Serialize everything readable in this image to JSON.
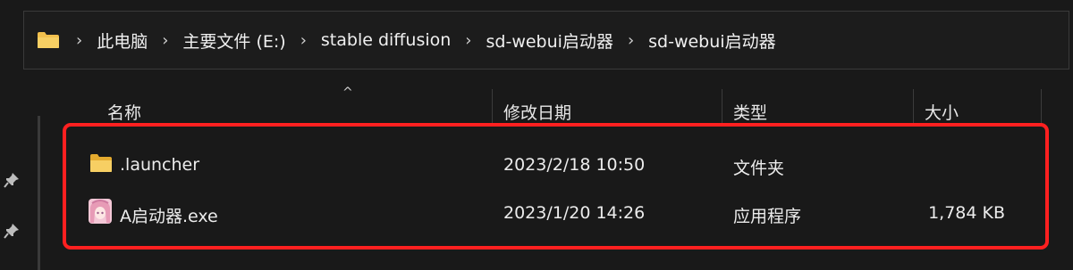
{
  "breadcrumb": [
    "此电脑",
    "主要文件 (E:)",
    "stable diffusion",
    "sd-webui启动器",
    "sd-webui启动器"
  ],
  "columns": {
    "name": "名称",
    "modified": "修改日期",
    "type": "类型",
    "size": "大小"
  },
  "files": [
    {
      "name": ".launcher",
      "modified": "2023/2/18 10:50",
      "type": "文件夹",
      "size": "",
      "icon": "folder-icon"
    },
    {
      "name": "A启动器.exe",
      "modified": "2023/1/20 14:26",
      "type": "应用程序",
      "size": "1,784 KB",
      "icon": "app-icon"
    }
  ],
  "colors": {
    "background": "#191919",
    "highlight": "#ff2020",
    "folder": "#f2c04d"
  }
}
